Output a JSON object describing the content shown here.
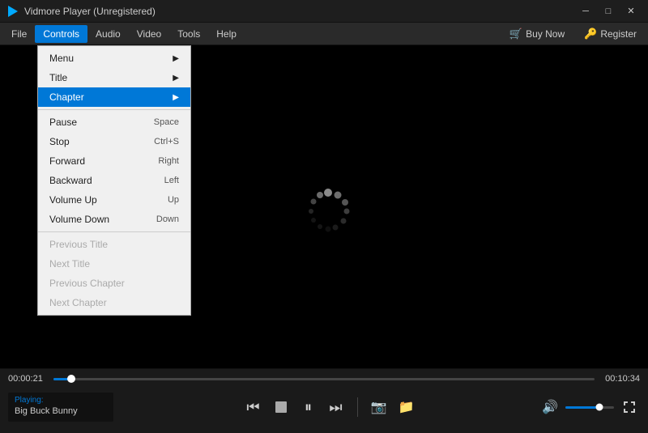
{
  "titleBar": {
    "title": "Vidmore Player (Unregistered)",
    "minimize": "─",
    "maximize": "□",
    "close": "✕"
  },
  "menuBar": {
    "items": [
      "File",
      "Controls",
      "Audio",
      "Video",
      "Tools",
      "Help"
    ],
    "activeItem": "Controls",
    "right": {
      "buyNow": "Buy Now",
      "register": "Register"
    }
  },
  "dropdown": {
    "items": [
      {
        "label": "Menu",
        "shortcut": "",
        "hasArrow": true,
        "disabled": false
      },
      {
        "label": "Title",
        "shortcut": "",
        "hasArrow": true,
        "disabled": false
      },
      {
        "label": "Chapter",
        "shortcut": "",
        "hasArrow": true,
        "disabled": false
      },
      {
        "separator": true
      },
      {
        "label": "Pause",
        "shortcut": "Space",
        "disabled": false
      },
      {
        "label": "Stop",
        "shortcut": "Ctrl+S",
        "disabled": false
      },
      {
        "label": "Forward",
        "shortcut": "Right",
        "disabled": false
      },
      {
        "label": "Backward",
        "shortcut": "Left",
        "disabled": false
      },
      {
        "label": "Volume Up",
        "shortcut": "Up",
        "disabled": false
      },
      {
        "label": "Volume Down",
        "shortcut": "Down",
        "disabled": false
      },
      {
        "separator": true
      },
      {
        "label": "Previous Title",
        "shortcut": "",
        "disabled": true
      },
      {
        "label": "Next Title",
        "shortcut": "",
        "disabled": true
      },
      {
        "label": "Previous Chapter",
        "shortcut": "",
        "disabled": true
      },
      {
        "label": "Next Chapter",
        "shortcut": "",
        "disabled": true
      }
    ]
  },
  "videoArea": {
    "spinnerVisible": true
  },
  "progressBar": {
    "timeLeft": "00:00:21",
    "timeRight": "00:10:34",
    "progressPercent": 3.3
  },
  "controls": {
    "playingLabel": "Playing:",
    "playingTitle": "Big Buck Bunny",
    "buttons": {
      "rewind": "⏮",
      "stop": "",
      "pause": "⏸",
      "forward": "⏭"
    }
  }
}
